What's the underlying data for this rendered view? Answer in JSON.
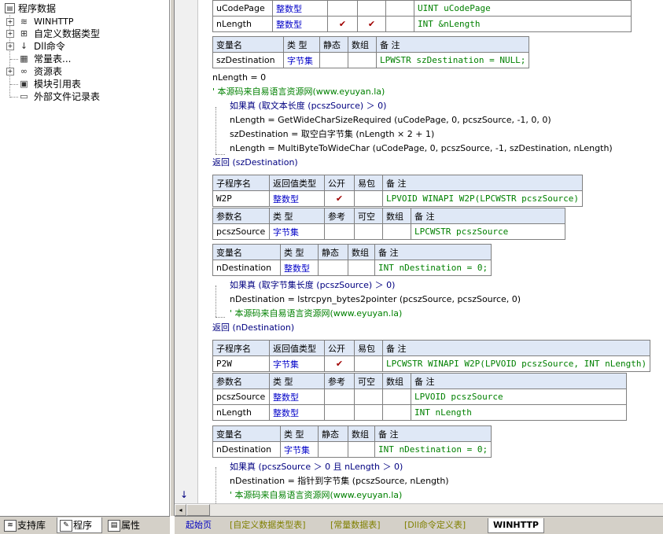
{
  "tree": {
    "root": "程序数据",
    "items": [
      {
        "label": "WINHTTP",
        "icon": "library-icon"
      },
      {
        "label": "自定义数据类型",
        "icon": "datatype-icon"
      },
      {
        "label": "Dll命令",
        "icon": "dll-icon"
      },
      {
        "label": "常量表...",
        "icon": "constant-icon"
      },
      {
        "label": "资源表",
        "icon": "resource-icon"
      },
      {
        "label": "模块引用表",
        "icon": "module-icon"
      },
      {
        "label": "外部文件记录表",
        "icon": "file-icon"
      }
    ]
  },
  "left_tabs": [
    "支持库",
    "程序",
    "属性"
  ],
  "editor_tabs": [
    "起始页",
    "[自定义数据类型表]",
    "[常量数据表]",
    "[Dll命令定义表]",
    "WINHTTP"
  ],
  "code": {
    "top_params": [
      {
        "name": "uCodePage",
        "type": "整数型",
        "ref": "",
        "opt": "",
        "arr": "",
        "note": "UINT uCodePage"
      },
      {
        "name": "nLength",
        "type": "整数型",
        "ref": "✔",
        "opt": "✔",
        "arr": "",
        "note": "INT &nLength"
      }
    ],
    "var_header": [
      "变量名",
      "类 型",
      "静态",
      "数组",
      "备 注"
    ],
    "sub_header": [
      "子程序名",
      "返回值类型",
      "公开",
      "易包",
      "备 注"
    ],
    "param_header": [
      "参数名",
      "类 型",
      "参考",
      "可空",
      "数组",
      "备 注"
    ],
    "block1": {
      "vars": [
        {
          "name": "szDestination",
          "type": "字节集",
          "note": "LPWSTR szDestination = NULL;"
        }
      ],
      "lines": [
        "nLength = 0",
        "' 本源码来自易语言资源网(www.eyuyan.la)",
        "如果真 (取文本长度 (pcszSource) ＞ 0)",
        "nLength = GetWideCharSizeRequired (uCodePage, 0, pcszSource, -1, 0, 0)",
        "szDestination = 取空白字节集 (nLength × 2 + 1)",
        "nLength = MultiByteToWideChar (uCodePage, 0, pcszSource, -1, szDestination, nLength)",
        "返回 (szDestination)"
      ]
    },
    "block2": {
      "sub": {
        "name": "W2P",
        "ret": "整数型",
        "pub": "✔",
        "note": "LPVOID WINAPI W2P(LPCWSTR pcszSource)"
      },
      "params": [
        {
          "name": "pcszSource",
          "type": "字节集",
          "note": "LPCWSTR pcszSource"
        }
      ],
      "vars": [
        {
          "name": "nDestination",
          "type": "整数型",
          "note": "INT nDestination = 0;"
        }
      ],
      "lines": [
        "如果真 (取字节集长度 (pcszSource) ＞ 0)",
        "nDestination = lstrcpyn_bytes2pointer (pcszSource, pcszSource, 0)",
        "' 本源码来自易语言资源网(www.eyuyan.la)",
        "返回 (nDestination)"
      ]
    },
    "block3": {
      "sub": {
        "name": "P2W",
        "ret": "字节集",
        "pub": "✔",
        "note": "LPCWSTR WINAPI W2P(LPVOID pcszSource, INT nLength)"
      },
      "params": [
        {
          "name": "pcszSource",
          "type": "整数型",
          "note": "LPVOID pcszSource"
        },
        {
          "name": "nLength",
          "type": "整数型",
          "note": "INT nLength"
        }
      ],
      "vars": [
        {
          "name": "nDestination",
          "type": "字节集",
          "note": "INT nDestination = 0;"
        }
      ],
      "lines": [
        "如果真 (pcszSource ＞ 0 且 nLength ＞ 0)",
        "nDestination = 指针到字节集 (pcszSource, nLength)",
        "' 本源码来自易语言资源网(www.eyuyan.la)"
      ]
    }
  }
}
